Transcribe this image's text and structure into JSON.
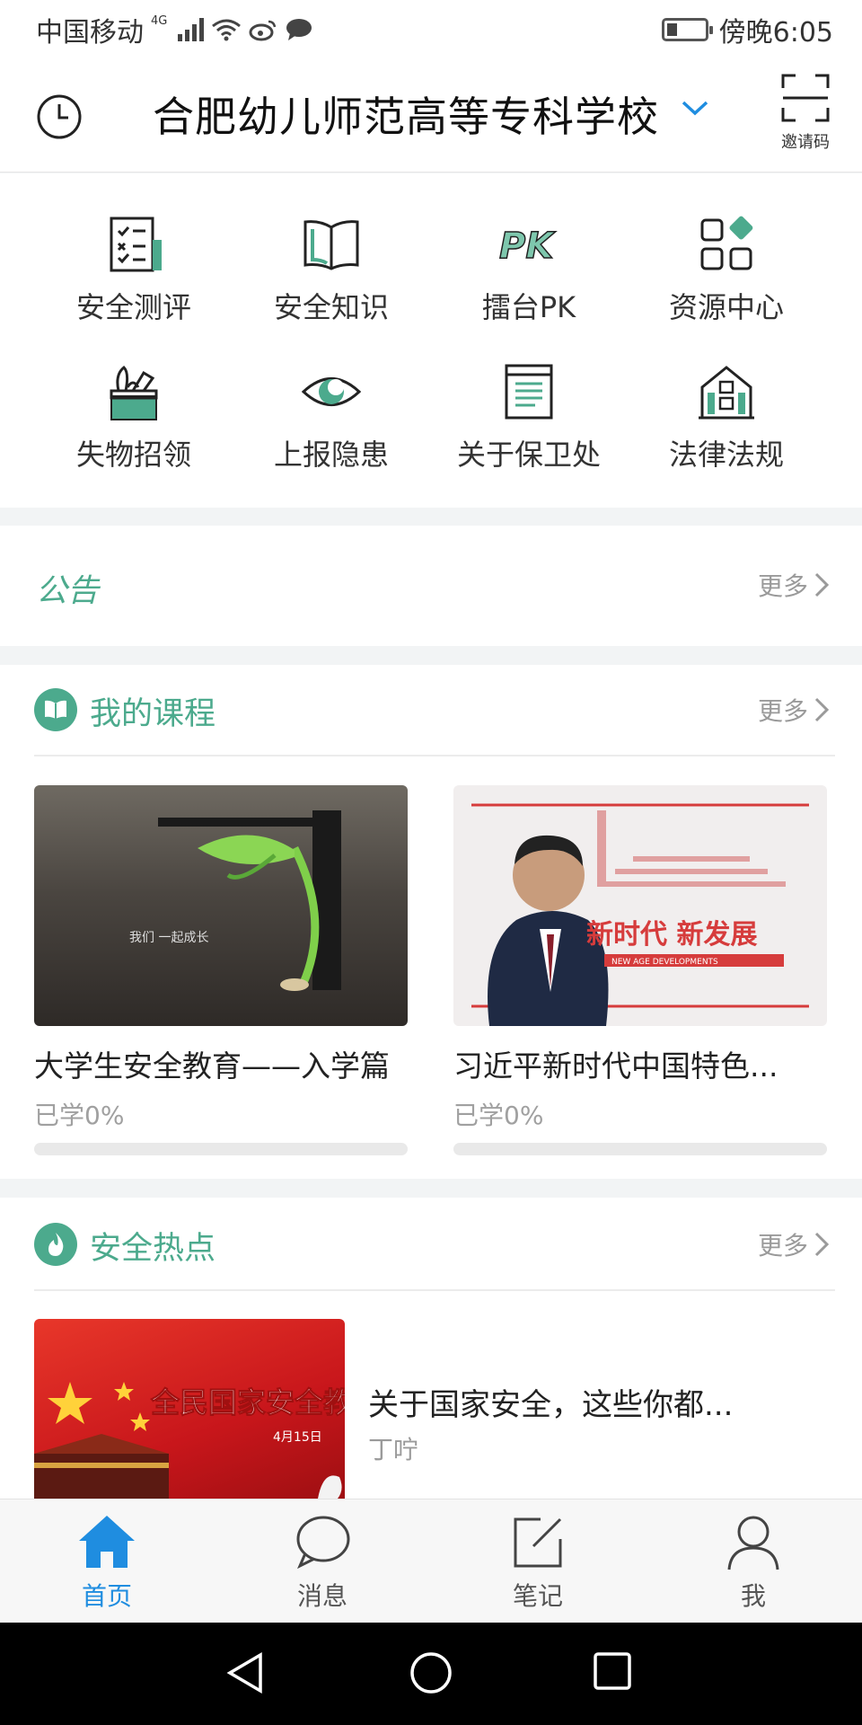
{
  "status_bar": {
    "carrier": "中国移动",
    "network": "4G",
    "time": "傍晚6:05"
  },
  "header": {
    "school": "合肥幼儿师范高等专科学校",
    "invite_label": "邀请码"
  },
  "features": [
    {
      "label": "安全测评",
      "icon": "checklist-icon"
    },
    {
      "label": "安全知识",
      "icon": "open-book-icon"
    },
    {
      "label": "擂台PK",
      "icon": "pk-icon"
    },
    {
      "label": "资源中心",
      "icon": "resource-grid-icon"
    },
    {
      "label": "失物招领",
      "icon": "lost-found-box-icon"
    },
    {
      "label": "上报隐患",
      "icon": "eye-report-icon"
    },
    {
      "label": "关于保卫处",
      "icon": "document-icon"
    },
    {
      "label": "法律法规",
      "icon": "building-icon"
    }
  ],
  "announcement": {
    "title": "公告",
    "more": "更多"
  },
  "courses": {
    "title": "我的课程",
    "more": "更多",
    "items": [
      {
        "name": "大学生安全教育——入学篇",
        "progress_text": "已学0%",
        "progress": 0,
        "thumb_caption": "我们  一起成长"
      },
      {
        "name": "习近平新时代中国特色...",
        "progress_text": "已学0%",
        "progress": 0,
        "thumb_headline": "新时代  新发展",
        "thumb_sub": "NEW AGE DEVELOPMENTS"
      }
    ]
  },
  "hot": {
    "title": "安全热点",
    "more": "更多",
    "item": {
      "title": "关于国家安全，这些你都...",
      "author": "丁咛",
      "thumb_banner": "全民国家安全教",
      "thumb_date": "4月15日"
    }
  },
  "tabs": [
    {
      "label": "首页",
      "icon": "home-icon",
      "active": true
    },
    {
      "label": "消息",
      "icon": "chat-bubble-icon",
      "active": false
    },
    {
      "label": "笔记",
      "icon": "note-edit-icon",
      "active": false
    },
    {
      "label": "我",
      "icon": "person-icon",
      "active": false
    }
  ],
  "colors": {
    "accent_green": "#4caa8d",
    "active_blue": "#1f8de0"
  }
}
